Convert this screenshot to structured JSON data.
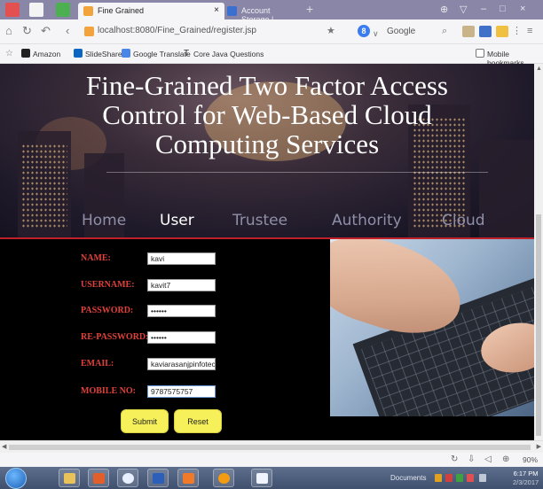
{
  "browser": {
    "tabs": [
      {
        "label": "Fine Grained",
        "active": true
      },
      {
        "label": "Account Storage | DriveHQ",
        "active": false
      }
    ],
    "url": "localhost:8080/Fine_Grained/register.jsp",
    "search_engine": "Google",
    "bookmarks": [
      "Amazon",
      "SlideShare",
      "Google Translate",
      "Core Java Questions"
    ],
    "mobile_bookmarks": "Mobile bookmarks",
    "zoom": "90%"
  },
  "page": {
    "title_lines": [
      "Fine-Grained Two Factor Access",
      "Control for Web-Based Cloud",
      "Computing Services"
    ],
    "menu": [
      {
        "label": "Home",
        "active": false
      },
      {
        "label": "User",
        "active": true
      },
      {
        "label": "Trustee",
        "active": false
      },
      {
        "label": "Authority",
        "active": false
      },
      {
        "label": "Cloud",
        "active": false
      }
    ],
    "form": {
      "name": {
        "label": "NAME:",
        "value": "kavi"
      },
      "username": {
        "label": "USERNAME:",
        "value": "kavit7"
      },
      "password": {
        "label": "PASSWORD:",
        "value": "••••••"
      },
      "repassword": {
        "label": "RE-PASSWORD:",
        "value": "••••••"
      },
      "email": {
        "label": "EMAIL:",
        "value": "kaviarasanjpinfotech@g"
      },
      "mobile": {
        "label": "MOBILE NO:",
        "value": "9787575757"
      },
      "submit": "Submit",
      "reset": "Reset"
    }
  },
  "taskbar": {
    "documents": "Documents",
    "time": "6:17 PM",
    "date": "2/3/2017"
  }
}
